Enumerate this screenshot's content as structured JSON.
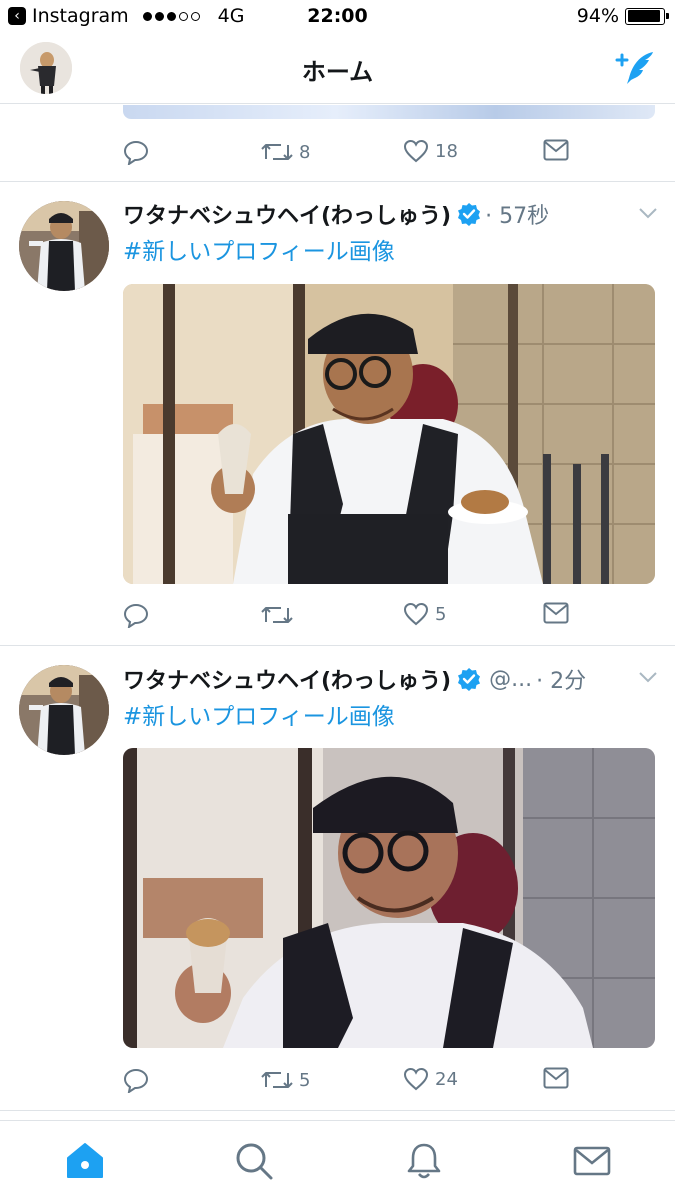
{
  "status_bar": {
    "back_label": "Instagram",
    "network": "4G",
    "time": "22:00",
    "battery": "94%",
    "battery_level": 0.94,
    "signal_bars": 3
  },
  "nav": {
    "title": "ホーム"
  },
  "prev_tweet": {
    "retweets": "8",
    "likes": "18"
  },
  "tweets": [
    {
      "name": "ワタナベシュウヘイ(わっしゅう)",
      "handle": "",
      "meta": "· 57秒",
      "text": "#新しいプロフィール画像",
      "replies": "",
      "retweets": "",
      "likes": "5"
    },
    {
      "name": "ワタナベシュウヘイ(わっしゅう)",
      "handle": "@...",
      "meta": "· 2分",
      "text": "#新しいプロフィール画像",
      "replies": "",
      "retweets": "5",
      "likes": "24"
    }
  ],
  "colors": {
    "accent": "#1da1f2",
    "link": "#1b95e0",
    "icon_gray": "#657786",
    "divider": "#dfe3e7"
  },
  "icons": [
    "back-icon",
    "compose-icon",
    "reply-icon",
    "retweet-icon",
    "like-icon",
    "dm-icon",
    "verified-icon",
    "chevron-down-icon",
    "home-icon",
    "search-icon",
    "notifications-icon",
    "messages-icon"
  ]
}
